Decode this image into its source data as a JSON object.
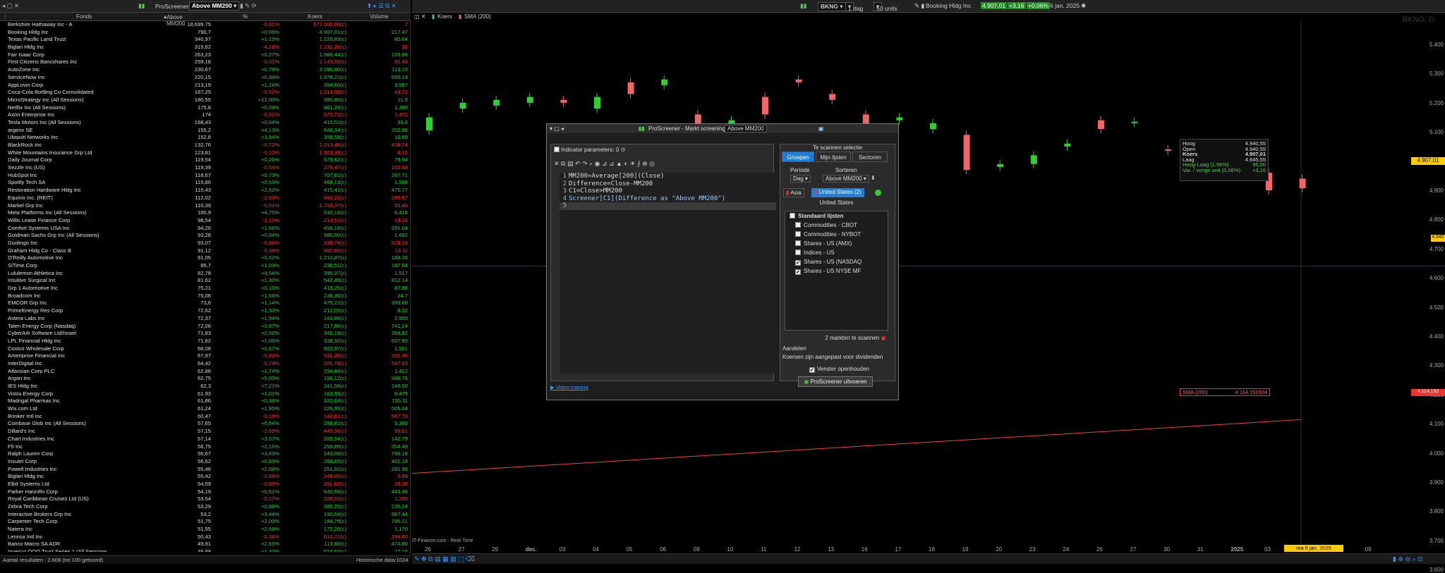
{
  "left_panel": {
    "title_tab": "ProScreener",
    "screen_select": "Above MM200",
    "columns": [
      "Fonds",
      "Above MM200",
      "%",
      "Koers",
      "Volume"
    ],
    "rows": [
      [
        "Berkshire Hathaway Inc - A",
        "18,699.75",
        "-0,61%",
        "677.000,00(c)",
        "7"
      ],
      [
        "Booking Hldg Inc",
        "790,7",
        "+0,06%",
        "4.907,01(c)",
        "217.47"
      ],
      [
        "Texas Pacific Land Trust",
        "340,97",
        "+1,15%",
        "1.225,83(c)",
        "80.64"
      ],
      [
        "Biglari Hldg Inc",
        "315,62",
        "-4,18%",
        "1.231,26(c)",
        "38"
      ],
      [
        "Fair Isaac Corp",
        "263,23",
        "+0,27%",
        "1.969,44(c)",
        "155.86"
      ],
      [
        "First Citizens Bancshares Inc",
        "259,18",
        "-0,31%",
        "2.143,93(c)",
        "81.43"
      ],
      [
        "AutoZone Inc",
        "230,67",
        "+0,78%",
        "3.295,80(c)",
        "113.15"
      ],
      [
        "ServiceNow Inc",
        "220,15",
        "+0,38%",
        "1.078,21(c)",
        "950.14"
      ],
      [
        "AppLovin Corp",
        "213,19",
        "+1,24%",
        "354,60(c)",
        "3.587"
      ],
      [
        "Coca-Cola Bottling Co Consolidated",
        "187,25",
        "-0,52%",
        "1.314,99(c)",
        "43.72"
      ],
      [
        "MicroStrategy Inc (All Sessions)",
        "180,55",
        "+12,00%",
        "380,80(c)",
        "11.5"
      ],
      [
        "Netflix Inc (All Sessions)",
        "175,8",
        "+0,09%",
        "881,24(c)",
        "1.389"
      ],
      [
        "Axon Enterprise Inc",
        "174",
        "-0,01%",
        "570,72(c)",
        "1.472"
      ],
      [
        "Tesla Motors Inc (All Sessions)",
        "168,43",
        "+0,04%",
        "410,51(c)",
        "33,6"
      ],
      [
        "argenx SE",
        "155,2",
        "+4,13%",
        "646,34(c)",
        "202.88"
      ],
      [
        "Ubiquiti Networks Inc",
        "152,8",
        "+3,94%",
        "356,59(c)",
        "15.69"
      ],
      [
        "BlackRock Inc",
        "132,76",
        "-0,72%",
        "1.013,48(c)",
        "439.24"
      ],
      [
        "White Mountains Insurance Grp Ltd",
        "123,81",
        "-0,10%",
        "1.923,39(c)",
        "8.15"
      ],
      [
        "Daily Journal Corp",
        "119,54",
        "+0,26%",
        "579,62(c)",
        "79.94"
      ],
      [
        "Sezzle Inc (US)",
        "119,39",
        "-0,54%",
        "276,47(c)",
        "102.68"
      ],
      [
        "HubSpot Inc",
        "118,67",
        "+0,73%",
        "707,81(c)",
        "267.71"
      ],
      [
        "Spotify Tech SA",
        "115,86",
        "+0,53%",
        "469,13(c)",
        "1.598"
      ],
      [
        "Restoration Hardware Hldg Inc",
        "115,43",
        "+2,52%",
        "415,41(c)",
        "475.77"
      ],
      [
        "Equinix Inc. (REIT)",
        "112,02",
        "-2,03%",
        "940,23(c)",
        "280.67"
      ],
      [
        "Markel Grp Inc",
        "110,39",
        "-0,51%",
        "1.704,37(c)",
        "51.43"
      ],
      [
        "Meta Platforms Inc (All Sessions)",
        "100,9",
        "+4,75%",
        "632,16(c)",
        "6.418"
      ],
      [
        "Willis Lease Finance Corp",
        "98,54",
        "-1,15%",
        "214,51(c)",
        "19.16"
      ],
      [
        "Comfort Systems USA Inc",
        "94,26",
        "+1,66%",
        "456,16(c)",
        "291.04"
      ],
      [
        "Goldman Sachs Grp Inc (All Sessions)",
        "93,28",
        "+0,94%",
        "585,00(c)",
        "1.692"
      ],
      [
        "Duolingo Inc",
        "93,07",
        "-0,98%",
        "336,74(c)",
        "529.16"
      ],
      [
        "Graham Hldg Co - Class B",
        "91,12",
        "-0,38%",
        "882,66(c)",
        "13.11"
      ],
      [
        "O'Reilly Automotive Inc",
        "91,05",
        "+0,52%",
        "1.210,87(c)",
        "189.26"
      ],
      [
        "SiTime Corp",
        "85,7",
        "+1,03%",
        "236,51(c)",
        "197.54"
      ],
      [
        "Lululemon Athletica Inc",
        "82,78",
        "+4,54%",
        "395,37(c)",
        "1.517"
      ],
      [
        "Intuitive Surgical Inc",
        "81,62",
        "+1,30%",
        "542,49(c)",
        "812.14"
      ],
      [
        "Grp 1 Automotive Inc",
        "75,21",
        "+0,16%",
        "419,25(c)",
        "87.88"
      ],
      [
        "Broadcom Inc",
        "75,06",
        "+1,66%",
        "236,36(c)",
        "24.7"
      ],
      [
        "EMCOR Grp Inc",
        "73,6",
        "+1,14%",
        "479,21(c)",
        "393.60"
      ],
      [
        "PrimeEnergy Res Corp",
        "72,62",
        "+1,30%",
        "212,05(c)",
        "8.32"
      ],
      [
        "Astera Labs Inc",
        "72,37",
        "+1,94%",
        "143,86(c)",
        "2.959"
      ],
      [
        "Talen Energy Corp (Nasdaq)",
        "72,06",
        "+0,97%",
        "217,86(c)",
        "741.24"
      ],
      [
        "CyberArk Software Ltd/Israel",
        "71,83",
        "+2,02%",
        "345,19(c)",
        "354.82"
      ],
      [
        "LPL Financial Hldg Inc",
        "71,62",
        "+1,05%",
        "336,32(c)",
        "507.85"
      ],
      [
        "Costco Wholesale Corp",
        "68,08",
        "+0,67%",
        "922,97(c)",
        "1.501"
      ],
      [
        "Ameriprise Financial Inc",
        "67,97",
        "-0,85%",
        "531,20(c)",
        "261.48"
      ],
      [
        "InterDigital Inc",
        "64,42",
        "-0,79%",
        "201,74(c)",
        "547.03"
      ],
      [
        "Atlassian Corp PLC",
        "62,88",
        "+1,74%",
        "254,84(c)",
        "1.412"
      ],
      [
        "Argan Inc",
        "62,75",
        "+5,00%",
        "156,12(c)",
        "386.76"
      ],
      [
        "IES Hldg Inc",
        "62,3",
        "+7,21%",
        "241,98(c)",
        "149.50"
      ],
      [
        "Vistra Energy Corp",
        "61,93",
        "+1,01%",
        "163,99(c)",
        "6.479"
      ],
      [
        "Madrigal Pharmas Inc",
        "61,86",
        "+0,38%",
        "320,64(c)",
        "155.11"
      ],
      [
        "Wix.com Ltd",
        "61,24",
        "+1,95%",
        "226,95(c)",
        "505.64"
      ],
      [
        "Brinker Intl Inc",
        "60,47",
        "-0,19%",
        "140,81(c)",
        "947.70"
      ],
      [
        "Coinbase Glob Inc (All Sessions)",
        "57,65",
        "+6,64%",
        "288,81(c)",
        "5.390"
      ],
      [
        "Dillard's Inc",
        "57,15",
        "-2,69%",
        "445,56(c)",
        "93.51"
      ],
      [
        "Chart Industries Inc",
        "57,14",
        "+3,07%",
        "205,94(c)",
        "142.79"
      ],
      [
        "F5 Inc",
        "56,75",
        "+2,16%",
        "259,89(c)",
        "354.49"
      ],
      [
        "Ralph Lauren Corp",
        "56,67",
        "+3,63%",
        "243,00(c)",
        "790.18"
      ],
      [
        "Insulet Corp",
        "56,62",
        "+0,83%",
        "268,65(c)",
        "401.18"
      ],
      [
        "Powell Industries Inc",
        "55,46",
        "+2,08%",
        "251,01(c)",
        "281.96"
      ],
      [
        "Biglari Hldg Inc",
        "55,42",
        "-3,96%",
        "248,05(c)",
        "5.99"
      ],
      [
        "Elbit Systems Ltd",
        "54,59",
        "-0,60%",
        "261,63(c)",
        "26.38"
      ],
      [
        "Parker Hannifin Corp",
        "54,19",
        "+0,51%",
        "640,69(c)",
        "483.96"
      ],
      [
        "Royal Caribbean Cruises Ltd (US)",
        "53,54",
        "-0,17%",
        "226,53(c)",
        "1.295"
      ],
      [
        "Zebra Tech Corp",
        "53,29",
        "+0,88%",
        "395,25(c)",
        "235.24"
      ],
      [
        "Interactive Brokers Grp Inc",
        "53,2",
        "+3,44%",
        "190,04(c)",
        "967.44"
      ],
      [
        "Carpenter Tech Corp",
        "51,75",
        "+2,00%",
        "184,79(c)",
        "785.21"
      ],
      [
        "Natera Inc",
        "51,55",
        "+2,69%",
        "172,26(c)",
        "1.170"
      ],
      [
        "Lennox Intl Inc",
        "50,43",
        "-0,34%",
        "610,72(c)",
        "294.60"
      ],
      [
        "Banco Macro SA ADR",
        "49,91",
        "+2,65%",
        "113,80(c)",
        "474.80"
      ],
      [
        "Invesco QQQ Trust Series 1 (All Sessions",
        "49,88",
        "+1,30%",
        "524,63(c)",
        "17.16"
      ]
    ],
    "footer_left": "Aantal resultaten : 2.608 (tot 100 getoond)",
    "footer_right": "Historische data:1024"
  },
  "chart": {
    "symbol": "BKNG",
    "period": "1 dag",
    "units": "50 units",
    "name": "Booking Hldg Inc",
    "price": "4.907,01",
    "change_abs": "+3,16",
    "change_pct": "+0,06%",
    "date": "6 jan. 2025",
    "tab_koers": "Koers",
    "tab_sma": "SMA (200)",
    "watermark": "BKNG, D",
    "source": "IT-Finance.com - Real-Time",
    "sma_label": "SMA (200)",
    "sma_value": "4.114,151924",
    "y_ticks": [
      "5.400",
      "5.300",
      "5.200",
      "5.100",
      "5.000",
      "4.900",
      "4.800",
      "4.700",
      "4.600",
      "4.500",
      "4.400",
      "4.300",
      "4.200",
      "4.100",
      "4.000",
      "3.900",
      "3.800",
      "3.700",
      "3.600"
    ],
    "price_tag": "4.907,01",
    "cross_tag": "4.640",
    "sma_tag": "4.114,152",
    "x_ticks": [
      "26",
      "27",
      "29",
      "dec.",
      "03",
      "04",
      "05",
      "06",
      "09",
      "10",
      "11",
      "12",
      "13",
      "16",
      "17",
      "18",
      "19",
      "20",
      "23",
      "24",
      "26",
      "27",
      "30",
      "31",
      "2025",
      "03",
      "07",
      "08",
      "09"
    ],
    "x_cursor": "ma 6 jan. 2025",
    "tooltip": {
      "rows": [
        [
          "Hoog",
          "4.940,55"
        ],
        [
          "Open",
          "4.940,55"
        ],
        [
          "Koers",
          "4.907,01"
        ],
        [
          "Laag",
          "4.845,55"
        ],
        [
          "Hoog-Laag (1,96%)",
          "95,00"
        ],
        [
          "Var. / vorige unit (0,06%)",
          "+3,16"
        ]
      ]
    },
    "chart_data": {
      "type": "candlestick",
      "series": [
        {
          "name": "SMA (200)",
          "values": [
            4114.151924
          ]
        }
      ],
      "last": {
        "open": 4940.55,
        "high": 4940.55,
        "low": 4845.55,
        "close": 4907.01
      },
      "candles": [
        [
          5105,
          5150
        ],
        [
          5180,
          5200
        ],
        [
          5190,
          5210
        ],
        [
          5200,
          5220
        ],
        [
          5210,
          5200
        ],
        [
          5180,
          5220
        ],
        [
          5270,
          5230
        ],
        [
          5260,
          5280
        ],
        [
          5160,
          5110
        ],
        [
          5110,
          5140
        ],
        [
          5220,
          5160
        ],
        [
          5280,
          5270
        ],
        [
          5230,
          5210
        ],
        [
          5160,
          5120
        ],
        [
          5140,
          5150
        ],
        [
          5110,
          5130
        ],
        [
          5090,
          4970
        ],
        [
          4980,
          4990
        ],
        [
          4990,
          5020
        ],
        [
          5050,
          5060
        ],
        [
          5140,
          5110
        ],
        [
          5130,
          5135
        ],
        [
          5040,
          5035
        ],
        [
          5010,
          5020
        ],
        [
          5000,
          5000
        ],
        [
          4960,
          4900
        ],
        [
          4940,
          4907
        ]
      ]
    }
  },
  "dialog": {
    "title": "ProScreener - Markt screening",
    "name": "Above MM200",
    "params_label": "Indicator parameters:",
    "params_count": "0",
    "code": [
      "MM200=Average[200](Close)",
      "Difference=Close-MM200",
      "C1=Close>MM200",
      "Screener[C1](Difference as \"Above MM200\")",
      ""
    ],
    "scan_title": "Te scannen selectie",
    "tabs": [
      "Groepen",
      "Mijn lijsten",
      "Sectoren"
    ],
    "period_label": "Periode",
    "period_value": "Dag",
    "sort_label": "Sorteren",
    "sort_value": "Above MM200",
    "region_asia": "Asia",
    "region_us": "United States (2)",
    "region_head": "United States",
    "list_items": [
      [
        "Standaard lijsten",
        false
      ],
      [
        "Commodities - CBOT",
        false
      ],
      [
        "Commodities - NYBOT",
        false
      ],
      [
        "Shares - US (AMX)",
        false
      ],
      [
        "Indices - US",
        false
      ],
      [
        "Shares - US (NASDAQ",
        true
      ],
      [
        "Shares - US NYSE MF",
        true
      ]
    ],
    "markets_count": "2 markten te scannen",
    "shares_title": "Aandelen",
    "shares_note": "Koersen zijn aangepast voor dividenden",
    "keep_open": "Venster openhouden",
    "run_button": "ProScreener uitvoeren",
    "video": "Video training"
  }
}
